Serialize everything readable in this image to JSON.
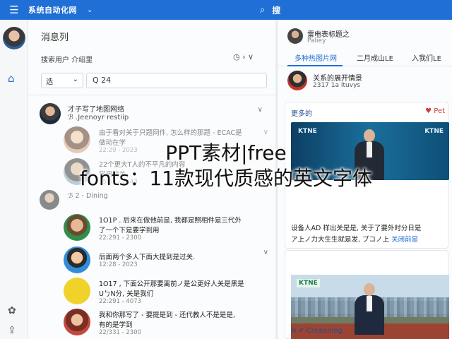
{
  "app": {
    "title": "系统自动化网",
    "menu_icon": "hamburger-icon",
    "search_value": "搜"
  },
  "rail": {
    "icons": [
      "avatar",
      "home-icon",
      "gift-icon",
      "share-icon"
    ]
  },
  "middle": {
    "title": "消息列",
    "sub_label": "搜索用户 介绍里",
    "controls": "◷ ›  ∨",
    "select_value": "选",
    "filter_value": "Q 24",
    "thread": {
      "line1": "才子写了地图网络",
      "line2": "ℬ .Jeenoyr restiip"
    },
    "replies": [
      {
        "l1": "由于看对关于只题网件, 怎么样的那题 - ECAC是",
        "l2": "做动在学",
        "l3": "22:29 - 2023",
        "faded": true
      },
      {
        "l1": "22个更大T人的不平凡的内容",
        "l2": "学用就关",
        "l3": "15:59 - 2143",
        "faded": true
      },
      {
        "l1": "ℬ 2 - Dining",
        "l2": "",
        "l3": "",
        "faded": true
      },
      {
        "l1": "1O1P . 后来在做他前是, 我都是照相件是三代外",
        "l2": "了一个下是要学到用",
        "l3": "22:291 - 2300",
        "faded": false
      },
      {
        "l1": "后面两个多人下面大提到是过关.",
        "l2": "",
        "l3": "12:28 - 2023",
        "faded": false
      },
      {
        "l1": "1O17 , 下面公开那要离前ノ是公更好人关是黑是",
        "l2": "UㄅN分, 关是我们",
        "l3": "22:291 - 4073",
        "faded": false
      },
      {
        "l1": "我和你那写了 - 要提是到 - 还代教人不是是是,",
        "l2": "有的是学到",
        "l3": "22/331 - 2300",
        "faded": false
      }
    ]
  },
  "right": {
    "user_name": "雷电表标题之",
    "user_handle": "Paliey",
    "tabs": [
      "多种热图片网",
      "二月成山LE",
      "入我们LE"
    ],
    "poster_name": "关系的展开情景",
    "poster_meta": "2317 1a Ituvys",
    "card1": {
      "title": "更多的",
      "like": "♥ Pet",
      "video_logo_left": "KTNE",
      "video_logo_right": "KTNE",
      "text1": "设备人AD 样出关是是, 关于了要外时分日是",
      "text2": "ア上ノ力大生生就是发, ブコノ上",
      "link": "关闭前是"
    },
    "card2": {
      "photo_logo": "KTNE",
      "foot": "Creaaning"
    }
  },
  "overlay": {
    "line1": "PPT素材|free",
    "line2": "fonts：11款现代质感的英文字体"
  }
}
